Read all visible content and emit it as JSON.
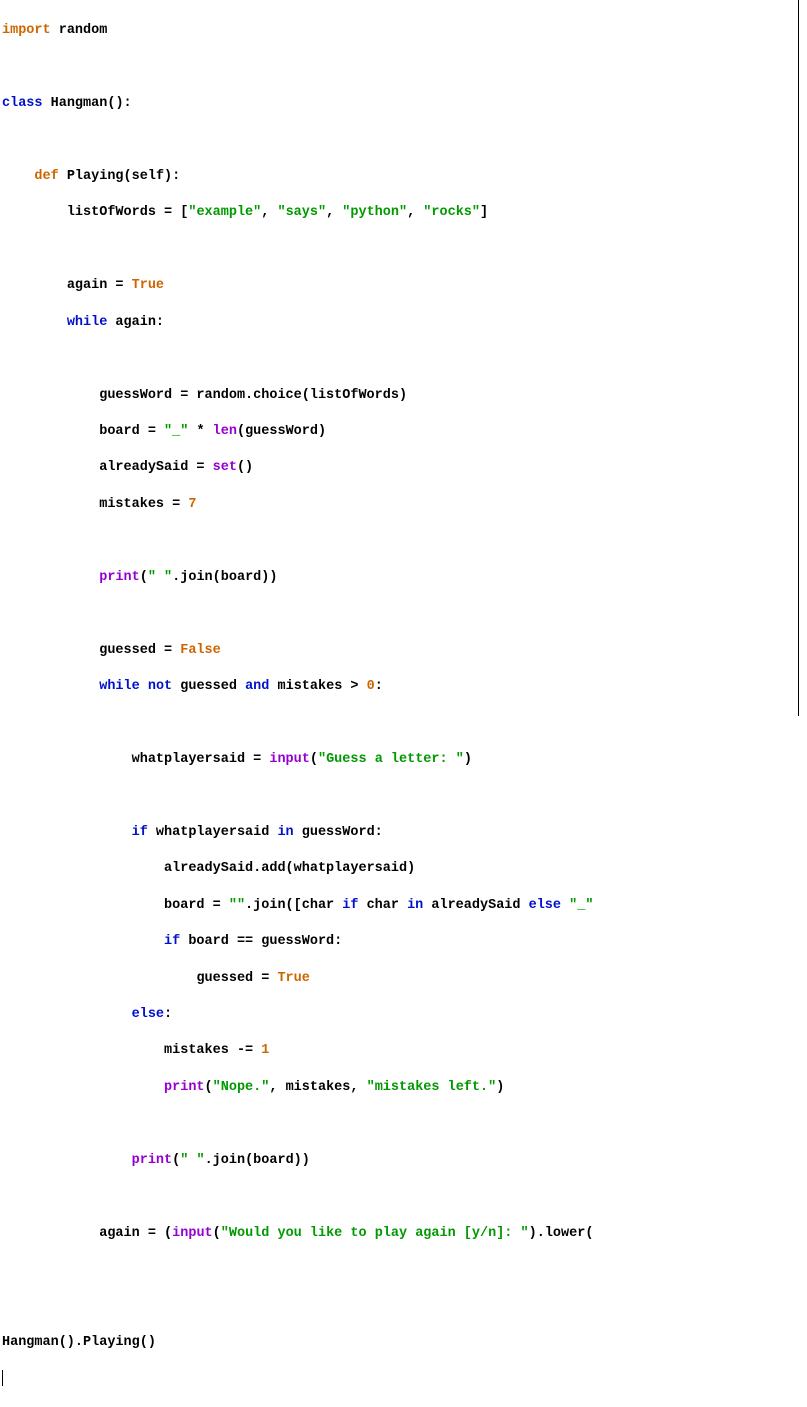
{
  "code": {
    "l1_import": "import",
    "l1_random": "random",
    "l3_class": "class",
    "l3_Hangman": "Hangman",
    "l3_paren": "():",
    "l5_def": "def",
    "l5_Playing": "Playing",
    "l5_self": "(self):",
    "l6a": "listOfWords = [",
    "l6_s1": "\"example\"",
    "l6_c1": ", ",
    "l6_s2": "\"says\"",
    "l6_c2": ", ",
    "l6_s3": "\"python\"",
    "l6_c3": ", ",
    "l6_s4": "\"rocks\"",
    "l6_end": "]",
    "l8_again": "again = ",
    "l8_True": "True",
    "l9_while": "while",
    "l9_again": " again:",
    "l11_gw": "guessWord = random.choice(listOfWords)",
    "l12_a": "board = ",
    "l12_s": "\"_\"",
    "l12_b": " * ",
    "l12_len": "len",
    "l12_c": "(guessWord)",
    "l13_a": "alreadySaid = ",
    "l13_set": "set",
    "l13_b": "()",
    "l14_a": "mistakes = ",
    "l14_7": "7",
    "l16_print": "print",
    "l16_a": "(",
    "l16_s": "\" \"",
    "l16_b": ".join(board))",
    "l18_a": "guessed = ",
    "l18_False": "False",
    "l19_while": "while",
    "l19_sp": " ",
    "l19_not": "not",
    "l19_g": " guessed ",
    "l19_and": "and",
    "l19_m": " mistakes > ",
    "l19_0": "0",
    "l19_c": ":",
    "l21_a": "whatplayersaid = ",
    "l21_input": "input",
    "l21_b": "(",
    "l21_s": "\"Guess a letter: \"",
    "l21_c": ")",
    "l23_if": "if",
    "l23_a": " whatplayersaid ",
    "l23_in": "in",
    "l23_b": " guessWord:",
    "l24": "alreadySaid.add(whatplayersaid)",
    "l25_a": "board = ",
    "l25_s1": "\"\"",
    "l25_b": ".join([char ",
    "l25_if": "if",
    "l25_c": " char ",
    "l25_in": "in",
    "l25_d": " alreadySaid ",
    "l25_else": "else",
    "l25_sp": " ",
    "l25_s2": "\"_\"",
    "l26_if": "if",
    "l26_a": " board == guessWord:",
    "l27_a": "guessed = ",
    "l27_True": "True",
    "l28_else": "else",
    "l28_c": ":",
    "l29_a": "mistakes -= ",
    "l29_1": "1",
    "l30_print": "print",
    "l30_a": "(",
    "l30_s1": "\"Nope.\"",
    "l30_b": ", mistakes, ",
    "l30_s2": "\"mistakes left.\"",
    "l30_c": ")",
    "l32_print": "print",
    "l32_a": "(",
    "l32_s": "\" \"",
    "l32_b": ".join(board))",
    "l34_a": "again = (",
    "l34_input": "input",
    "l34_b": "(",
    "l34_s": "\"Would you like to play again [y/n]: \"",
    "l34_c": ").lower(",
    "l37": "Hangman().Playing()"
  }
}
